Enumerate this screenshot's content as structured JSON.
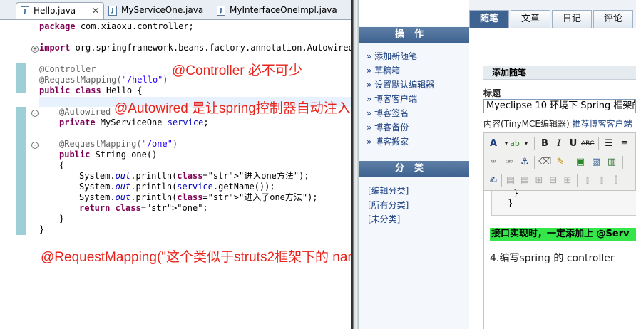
{
  "editor": {
    "tabs": [
      {
        "label": "Hello.java",
        "active": true
      },
      {
        "label": "MyServiceOne.java",
        "active": false
      },
      {
        "label": "MyInterfaceOneImpl.java",
        "active": false
      }
    ],
    "close_glyph": "✕",
    "code": [
      "package com.xiaoxu.controller;",
      "import org.springframework.beans.factory.annotation.Autowired;",
      "@Controller",
      "@RequestMapping(\"/hello\")",
      "public class Hello {",
      "@Autowired",
      "private MyServiceOne service;",
      "@RequestMapping(\"/one\")",
      "public String one()",
      "{",
      "System.out.println(\"进入one方法\");",
      "System.out.println(service.getName());",
      "System.out.println(\"进入了one方法\");",
      "return \"one\";",
      "}",
      "}"
    ],
    "notes": {
      "controller": "@Controller 必不可少",
      "autowired": "@Autowired 是让spring控制器自动注入",
      "requestmapping": "@RequestMapping(\"这个类似于struts2框架下的 namespace\")"
    },
    "colors": {
      "note": "#e8231c",
      "keyword": "#7f0055",
      "annotation": "#646464",
      "string": "#2a00ff",
      "field": "#0000c0"
    }
  },
  "blog": {
    "nav": {
      "ops_title": "操作",
      "ops_items": [
        "添加新随笔",
        "草稿箱",
        "设置默认编辑器",
        "博客客户端",
        "博客签名",
        "博客备份",
        "博客搬家"
      ],
      "cat_title": "分类",
      "cat_items": [
        "[编辑分类]",
        "[所有分类]",
        "[未分类]"
      ]
    },
    "tabs": [
      "随笔",
      "文章",
      "日记",
      "评论"
    ],
    "section_title": "添加随笔",
    "title_label": "标题",
    "title_value": "Myeclipse 10 环境下 Spring 框架的",
    "content_label": "内容(TinyMCE编辑器)",
    "content_link": "推荐博客客户端",
    "code_brace_1": "}",
    "code_brace_2": "}",
    "highlight_text": "接口实现时，一定添加上 @Serv",
    "step_text": "4.编写spring 的 controller",
    "colors": {
      "nav_header": "#3f6391",
      "link": "#1a3f80",
      "highlight": "#35e64a"
    }
  }
}
